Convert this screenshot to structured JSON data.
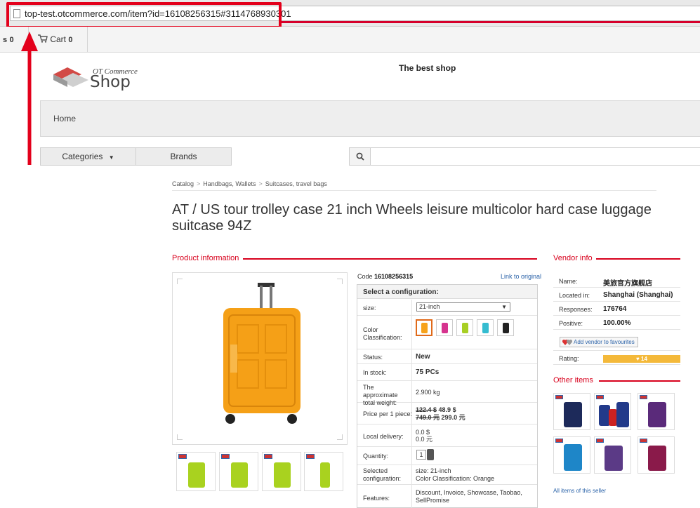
{
  "browser": {
    "url": "top-test.otcommerce.com/item?id=16108256315#3114768930301"
  },
  "topbar": {
    "favorites_count": "0",
    "cart_label": "Cart",
    "cart_count": "0"
  },
  "header": {
    "logo_top": "OT Commerce",
    "logo_main": "Shop",
    "slogan": "The best shop"
  },
  "nav": {
    "home": "Home",
    "categories": "Categories",
    "brands": "Brands",
    "search_placeholder": ""
  },
  "breadcrumb": [
    "Catalog",
    "Handbags, Wallets",
    "Suitcases, travel bags"
  ],
  "product": {
    "title": "AT / US tour trolley case 21 inch Wheels leisure multicolor hard case luggage suitcase 94Z",
    "section_title": "Product information",
    "code_label": "Code",
    "code_value": "16108256315",
    "link_original": "Link to original",
    "config_title": "Select a configuration:",
    "size_label": "size:",
    "size_value": "21-inch",
    "color_label": "Color Classification:",
    "swatch_colors": [
      "#f7a21b",
      "#d6338e",
      "#a8cf24",
      "#35bcd0",
      "#222222"
    ],
    "status_label": "Status:",
    "status_value": "New",
    "stock_label": "In stock:",
    "stock_value": "75 PCs",
    "weight_label": "The approximate total weight:",
    "weight_value": "2.900 kg",
    "price_label": "Price per 1 piece:",
    "price_old_usd": "122.4 $",
    "price_new_usd": "48.9 $",
    "price_old_cny": "749.0 元",
    "price_new_cny": "299.0 元",
    "delivery_label": "Local delivery:",
    "delivery_usd": "0.0 $",
    "delivery_cny": "0.0 元",
    "quantity_label": "Quantity:",
    "quantity_value": "1",
    "selected_label": "Selected configuration:",
    "selected_size": "size: 21-inch",
    "selected_color": "Color Classification: Orange",
    "features_label": "Features:",
    "features_value": "Discount, Invoice, Showcase, Taobao, SellPromise",
    "thumb_colors": [
      "#a9d21f",
      "#a9d21f",
      "#a9d21f",
      "#a9d21f"
    ]
  },
  "vendor": {
    "section_title": "Vendor info",
    "name_label": "Name:",
    "name_value": "美旅官方旗舰店",
    "location_label": "Located in:",
    "location_value": "Shanghai (Shanghai)",
    "responses_label": "Responses:",
    "responses_value": "176764",
    "positive_label": "Positive:",
    "positive_value": "100.00%",
    "favourites_button": "Add vendor to favourites",
    "rating_label": "Rating:",
    "rating_value": "14",
    "other_title": "Other items",
    "other_colors": [
      "#1d2a5a",
      "#223a8a",
      "#5a2a7a",
      "#1e86c8",
      "#5b3a86",
      "#8a1a4a"
    ],
    "all_items": "All items of this seller"
  },
  "colors": {
    "accent_red": "#d8001c",
    "link_blue": "#2a62a8",
    "highlight": "#e3001b"
  }
}
